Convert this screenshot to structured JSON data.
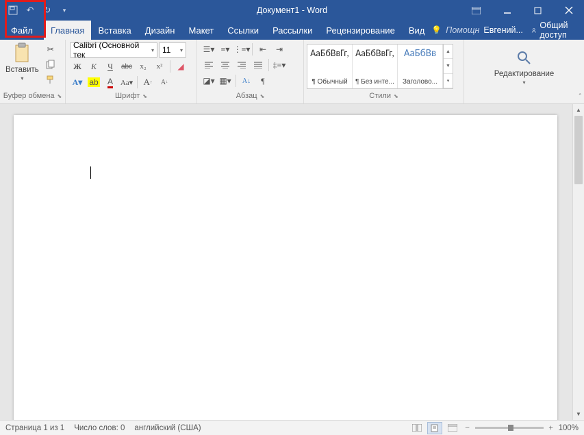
{
  "title": "Документ1 - Word",
  "tabs": {
    "file": "Файл",
    "list": [
      "Главная",
      "Вставка",
      "Дизайн",
      "Макет",
      "Ссылки",
      "Рассылки",
      "Рецензирование",
      "Вид"
    ],
    "help": "Помощн",
    "user": "Евгений...",
    "share": "Общий доступ"
  },
  "ribbon": {
    "clipboard": {
      "paste": "Вставить",
      "label": "Буфер обмена"
    },
    "font": {
      "label": "Шрифт",
      "name": "Calibri (Основной тек",
      "size": "11",
      "bold": "Ж",
      "italic": "К",
      "underline": "Ч",
      "strike": "abc",
      "sub": "x₂",
      "sup": "x²"
    },
    "paragraph": {
      "label": "Абзац"
    },
    "styles": {
      "label": "Стили",
      "items": [
        {
          "preview": "АаБбВвГг,",
          "name": "¶ Обычный"
        },
        {
          "preview": "АаБбВвГг,",
          "name": "¶ Без инте..."
        },
        {
          "preview": "АаБбВв",
          "name": "Заголово..."
        }
      ]
    },
    "editing": {
      "label": "Редактирование"
    }
  },
  "status": {
    "page": "Страница 1 из 1",
    "words": "Число слов: 0",
    "lang": "английский (США)",
    "zoom": "100%"
  }
}
